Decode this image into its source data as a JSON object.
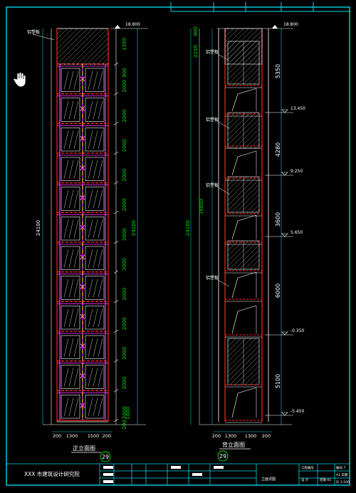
{
  "front_view": {
    "title": "正立面图",
    "sheet_no": "29",
    "material_label": "铝塑板",
    "top_elevation": "18.800",
    "overall_height": "24100",
    "right_overall": "24100",
    "segments": [
      "1350",
      "900",
      "2000",
      "2000",
      "2000",
      "2000",
      "2000",
      "2000",
      "2000",
      "2000",
      "2000",
      "2000",
      "2000",
      "2000"
    ],
    "bottom_segments": [
      "200",
      "1000"
    ],
    "bottom_widths": [
      "200",
      "1300",
      "1500",
      "200"
    ]
  },
  "back_view": {
    "title": "背立面图",
    "sheet_no": "29",
    "material_labels": [
      "铝塑板",
      "铝塑板",
      "铝塑板",
      "铝塑板"
    ],
    "top_elevation": "18.800",
    "top_seg": "2150",
    "top_small": "900",
    "overall_height": "24100",
    "inner_height": "16850",
    "right_segments": [
      "5350",
      "4280",
      "3600",
      "6000",
      "5100"
    ],
    "elevations": [
      "13.450",
      "9.250",
      "5.650",
      "-0.350",
      "-5.450"
    ],
    "bottom_widths": [
      "200",
      "1300",
      "1300",
      "200"
    ]
  },
  "title_block": {
    "company": "XXX 市建筑设计研究院",
    "drawing_name": "立面详图",
    "col_a": "工程编号",
    "col_b": "设 计",
    "col_c": "结施-01",
    "r1": "编号:7",
    "r2": "A1 日期",
    "r3": "比 1:100"
  },
  "colors": {
    "frame": "#00d7e8",
    "dim": "#00e000",
    "glass": "#ffffff",
    "magenta": "#ff33ff",
    "red": "#ff2020",
    "yellow": "#ffe600"
  },
  "icons": {
    "cursor": "hand-pointer-icon"
  }
}
